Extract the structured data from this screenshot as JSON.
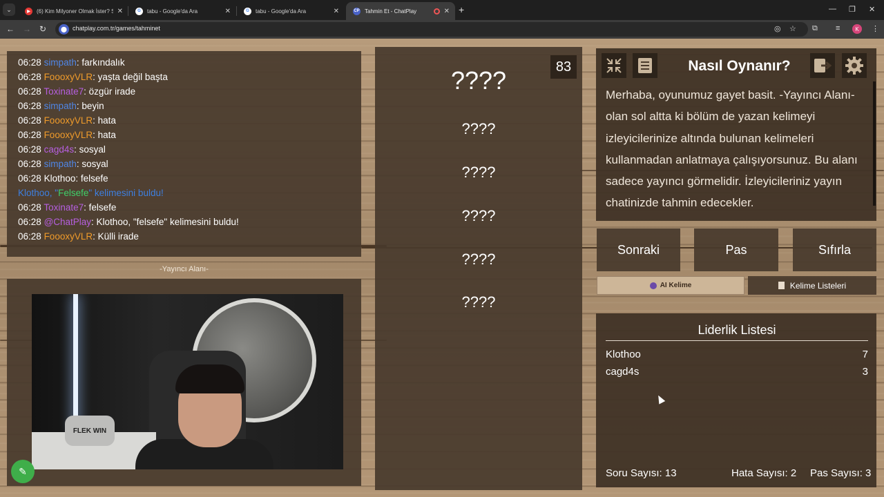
{
  "browser": {
    "tabs": [
      {
        "title": "(6) Kim Milyoner Olmak İster? S",
        "fav": "▶",
        "fav_color": "#e53935",
        "active": false
      },
      {
        "title": "tabu - Google'da Ara",
        "fav": "G",
        "fav_color": "#ffffff",
        "active": false
      },
      {
        "title": "tabu - Google'da Ara",
        "fav": "G",
        "fav_color": "#ffffff",
        "active": false
      },
      {
        "title": "Tahmin Et - ChatPlay",
        "fav": "CP",
        "fav_color": "#4a63c8",
        "active": true
      }
    ],
    "url": "chatplay.com.tr/games/tahminet",
    "profile_initial": "K"
  },
  "chat": {
    "lines": [
      {
        "time": "06:28",
        "user": "simpath",
        "color": "#4f86e6",
        "msg": ": farkındalık"
      },
      {
        "time": "06:28",
        "user": "FoooxyVLR",
        "color": "#f09b2a",
        "msg": ": yaşta değil başta"
      },
      {
        "time": "06:28",
        "user": "Toxinate7",
        "color": "#b65fe0",
        "msg": ": özgür irade"
      },
      {
        "time": "06:28",
        "user": "simpath",
        "color": "#4f86e6",
        "msg": ": beyin"
      },
      {
        "time": "06:28",
        "user": "FoooxyVLR",
        "color": "#f09b2a",
        "msg": ": hata"
      },
      {
        "time": "06:28",
        "user": "FoooxyVLR",
        "color": "#f09b2a",
        "msg": ": hata"
      },
      {
        "time": "06:28",
        "user": "cagd4s",
        "color": "#b65fe0",
        "msg": ": sosyal"
      },
      {
        "time": "06:28",
        "user": "simpath",
        "color": "#4f86e6",
        "msg": ": sosyal"
      },
      {
        "time": "06:28",
        "user": "Klothoo",
        "color": "#ffffff",
        "msg": ": felsefe"
      },
      {
        "system": true,
        "parts": [
          "Klothoo, \"",
          "Felsefe",
          "\" kelimesini buldu!"
        ]
      },
      {
        "time": "06:28",
        "user": "Toxinate7",
        "color": "#b65fe0",
        "msg": ": felsefe"
      },
      {
        "time": "06:28",
        "user": "@ChatPlay",
        "color": "#b65fe0",
        "msg": ": Klothoo, \"felsefe\" kelimesini buldu!"
      },
      {
        "time": "06:28",
        "user": "FoooxyVLR",
        "color": "#f09b2a",
        "msg": ": Külli irade"
      }
    ]
  },
  "video": {
    "caption": "-Yayıncı Alanı-",
    "pillow_text": "FLEK WIN"
  },
  "words": {
    "counter": "83",
    "main": "????",
    "forbidden": [
      "????",
      "????",
      "????",
      "????",
      "????"
    ]
  },
  "howto": {
    "title": "Nasıl Oynanır?",
    "text": "Merhaba, oyunumuz gayet basit. -Yayıncı Alanı- olan sol altta ki bölüm de yazan kelimeyi izleyicilerinize altında bulunan kelimeleri kullanmadan anlatmaya çalışıyorsunuz. Bu alanı sadece yayıncı görmelidir. İzleyicileriniz yayın chatinizde tahmin edecekler."
  },
  "controls": {
    "next": "Sonraki",
    "pass": "Pas",
    "reset": "Sıfırla",
    "ai_word": "AI Kelime",
    "word_lists": "Kelime Listeleri"
  },
  "leaderboard": {
    "title": "Liderlik Listesi",
    "rows": [
      {
        "name": "Klothoo",
        "score": "7"
      },
      {
        "name": "cagd4s",
        "score": "3"
      }
    ],
    "stats": {
      "questions": "Soru Sayısı: 13",
      "errors": "Hata Sayısı: 2",
      "passes": "Pas Sayısı: 3"
    }
  },
  "colors": {
    "system_blue": "#3e7fe0",
    "system_green": "#3fd06b"
  }
}
